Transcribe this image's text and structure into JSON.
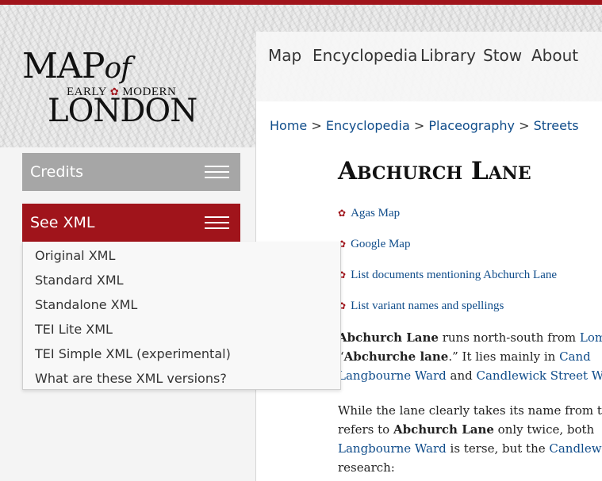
{
  "logo": {
    "line1": "MAP",
    "line1_of": "of",
    "line2_left": "EARLY",
    "line2_right": "MODERN",
    "line3": "LONDON"
  },
  "nav": {
    "items": [
      "Map",
      "Encyclopedia",
      "Library",
      "Stow",
      "About"
    ]
  },
  "sidebar": {
    "credits_label": "Credits",
    "seexml_label": "See XML",
    "xml_menu": [
      "Original XML",
      "Standard XML",
      "Standalone XML",
      "TEI Lite XML",
      "TEI Simple XML (experimental)",
      "What are these XML versions?"
    ]
  },
  "breadcrumb": {
    "items": [
      "Home",
      "Encyclopedia",
      "Placeography",
      "Streets"
    ],
    "separator": ">"
  },
  "page": {
    "title": "Abchurch Lane",
    "links": [
      "Agas Map",
      "Google Map",
      "List documents mentioning Abchurch Lane",
      "List variant names and spellings"
    ],
    "p1": {
      "l1_bold": "Abchurch Lane",
      "l1_text": " runs north-south from ",
      "l1_link": "Lom",
      "l2_open": "“",
      "l2_bold": "Abchurche lane",
      "l2_text": ".” It lies mainly in ",
      "l2_link": "Cand",
      "l3_link1": "Langbourne Ward",
      "l3_and": " and ",
      "l3_link2": "Candlewick Street Wa"
    },
    "p2": {
      "l1_text": "While the lane clearly takes its name from t",
      "l2_pre": "refers to ",
      "l2_bold": "Abchurch Lane",
      "l2_post": " only twice, both",
      "l3_link1": "Langbourne Ward",
      "l3_mid": " is terse, but the ",
      "l3_link2": "Candlew",
      "l4": "research:"
    }
  },
  "colors": {
    "brand_red": "#a0141b",
    "link_blue": "#0f4c8a",
    "credits_gray": "#a6a6a6"
  }
}
